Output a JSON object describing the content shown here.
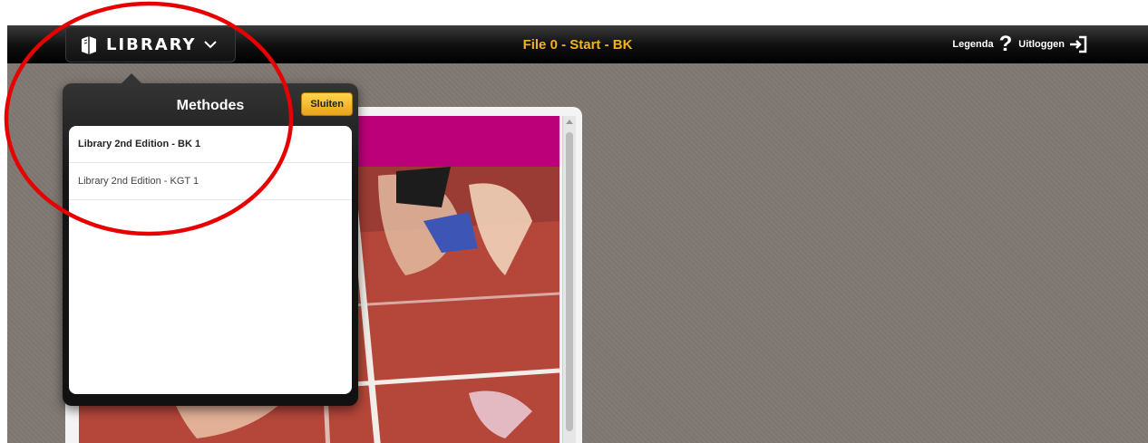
{
  "header": {
    "logo_text": "LIBRARY",
    "title": "File 0 - Start - BK",
    "legenda_label": "Legenda",
    "help_glyph": "?",
    "logout_label": "Uitloggen"
  },
  "popover": {
    "title": "Methodes",
    "close_label": "Sluiten",
    "items": [
      {
        "label": "Library 2nd Edition - BK 1",
        "selected": true
      },
      {
        "label": "Library 2nd Edition - KGT 1",
        "selected": false
      }
    ]
  },
  "icons": {
    "logo": "book-icon",
    "dropdown": "chevron-down-icon",
    "help": "question-mark-icon",
    "logout": "logout-icon"
  },
  "colors": {
    "title_accent": "#f0b323",
    "close_button": "#f2b52a",
    "cover_band": "#bc0079",
    "annotation": "#e60000"
  }
}
